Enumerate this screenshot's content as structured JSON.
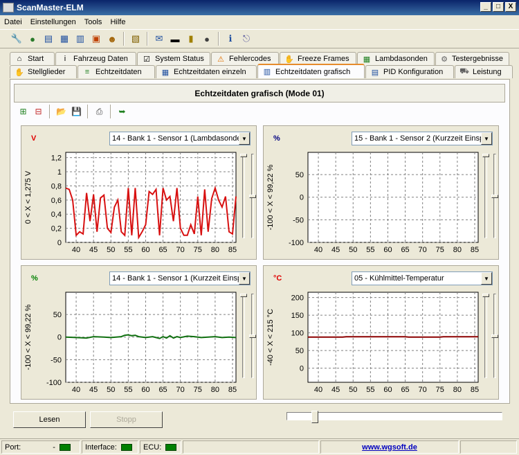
{
  "window": {
    "title": "ScanMaster-ELM",
    "btn_min": "_",
    "btn_max": "□",
    "btn_close": "X"
  },
  "menu": [
    "Datei",
    "Einstellungen",
    "Tools",
    "Hilfe"
  ],
  "tabs_row1": [
    {
      "label": "Start",
      "icon": "home-icon",
      "glyph": "⌂"
    },
    {
      "label": "Fahrzeug Daten",
      "icon": "info-icon",
      "glyph": "i"
    },
    {
      "label": "System Status",
      "icon": "check-icon",
      "glyph": "☑"
    },
    {
      "label": "Fehlercodes",
      "icon": "warning-icon",
      "glyph": "⚠"
    },
    {
      "label": "Freeze Frames",
      "icon": "hand-icon",
      "glyph": "✋"
    },
    {
      "label": "Lambdasonden",
      "icon": "sensor-icon",
      "glyph": "▦"
    },
    {
      "label": "Testergebnisse",
      "icon": "gear-icon",
      "glyph": "⚙"
    }
  ],
  "tabs_row2": [
    {
      "label": "Stellglieder",
      "icon": "hand-icon",
      "glyph": "✋"
    },
    {
      "label": "Echtzeitdaten",
      "icon": "list-icon",
      "glyph": "≡"
    },
    {
      "label": "Echtzeitdaten einzeln",
      "icon": "grid-icon",
      "glyph": "▦"
    },
    {
      "label": "Echtzeitdaten grafisch",
      "icon": "chart-icon",
      "glyph": "▥",
      "active": true
    },
    {
      "label": "PID Konfiguration",
      "icon": "doc-icon",
      "glyph": "▤"
    },
    {
      "label": "Leistung",
      "icon": "car-icon",
      "glyph": "⛟"
    }
  ],
  "header": "Echtzeitdaten grafisch (Mode 01)",
  "charts": [
    {
      "unit": "V",
      "unit_color": "#e00000",
      "sensor": "14 - Bank 1 - Sensor 1 (Lambdasonde ...",
      "range_min": "0",
      "range_sep": "< X <",
      "range_max": "1,275",
      "range_unit": "V",
      "line_color": "#d81010",
      "thumb_pos": 0.5,
      "chart_data": {
        "type": "line",
        "x_ticks": [
          "40",
          "45",
          "50",
          "55",
          "60",
          "65",
          "70",
          "75",
          "80",
          "85"
        ],
        "y_ticks": [
          "1,2",
          "1",
          "0,8",
          "0,6",
          "0,4",
          "0,2",
          "0"
        ],
        "ylim": [
          0,
          1.275
        ],
        "xlim": [
          37,
          86
        ],
        "series": [
          {
            "values": [
              [
                37,
                0.77
              ],
              [
                38,
                0.75
              ],
              [
                39,
                0.6
              ],
              [
                40,
                0.1
              ],
              [
                41,
                0.15
              ],
              [
                42,
                0.12
              ],
              [
                43,
                0.7
              ],
              [
                44,
                0.3
              ],
              [
                45,
                0.68
              ],
              [
                46,
                0.15
              ],
              [
                47,
                0.63
              ],
              [
                48,
                0.67
              ],
              [
                49,
                0.2
              ],
              [
                50,
                0.14
              ],
              [
                51,
                0.5
              ],
              [
                52,
                0.6
              ],
              [
                53,
                0.15
              ],
              [
                54,
                0.1
              ],
              [
                55,
                0.77
              ],
              [
                56,
                0.1
              ],
              [
                57,
                0.77
              ],
              [
                58,
                0.07
              ],
              [
                59,
                0.15
              ],
              [
                60,
                0.25
              ],
              [
                61,
                0.72
              ],
              [
                62,
                0.68
              ],
              [
                63,
                0.75
              ],
              [
                64,
                0.1
              ],
              [
                65,
                0.77
              ],
              [
                66,
                0.6
              ],
              [
                67,
                0.65
              ],
              [
                68,
                0.3
              ],
              [
                69,
                0.77
              ],
              [
                70,
                0.2
              ],
              [
                71,
                0.1
              ],
              [
                72,
                0.1
              ],
              [
                73,
                0.25
              ],
              [
                74,
                0.12
              ],
              [
                75,
                0.65
              ],
              [
                76,
                0.1
              ],
              [
                77,
                0.75
              ],
              [
                78,
                0.15
              ],
              [
                79,
                0.62
              ],
              [
                80,
                0.77
              ],
              [
                81,
                0.6
              ],
              [
                82,
                0.5
              ],
              [
                83,
                0.65
              ],
              [
                84,
                0.15
              ],
              [
                85,
                0.12
              ],
              [
                86,
                0.65
              ]
            ]
          }
        ]
      }
    },
    {
      "unit": "%",
      "unit_color": "#000080",
      "sensor": "15 - Bank 1 - Sensor 2 (Kurzzeit Einspr",
      "range_min": "-100",
      "range_sep": "< X <",
      "range_max": "99,22",
      "range_unit": "%",
      "line_color": "#000080",
      "thumb_pos": 0.5,
      "chart_data": {
        "type": "line",
        "x_ticks": [
          "40",
          "45",
          "50",
          "55",
          "60",
          "65",
          "70",
          "75",
          "80",
          "85"
        ],
        "y_ticks": [
          "50",
          "0",
          "-50",
          "-100"
        ],
        "ylim": [
          -100,
          99.22
        ],
        "xlim": [
          37,
          86
        ],
        "series": []
      }
    },
    {
      "unit": "%",
      "unit_color": "#008000",
      "sensor": "14 - Bank 1 - Sensor 1 (Kurzzeit Einspr",
      "range_min": "-100",
      "range_sep": "< X <",
      "range_max": "99,22",
      "range_unit": "%",
      "line_color": "#107010",
      "thumb_pos": 0.5,
      "chart_data": {
        "type": "line",
        "x_ticks": [
          "40",
          "45",
          "50",
          "55",
          "60",
          "65",
          "70",
          "75",
          "80",
          "85"
        ],
        "y_ticks": [
          "50",
          "0",
          "-50",
          "-100"
        ],
        "ylim": [
          -100,
          99.22
        ],
        "xlim": [
          37,
          86
        ],
        "series": [
          {
            "values": [
              [
                37,
                0
              ],
              [
                40,
                -1
              ],
              [
                43,
                -2
              ],
              [
                45,
                1
              ],
              [
                48,
                0
              ],
              [
                50,
                -1
              ],
              [
                53,
                1
              ],
              [
                54,
                4
              ],
              [
                55,
                5
              ],
              [
                56,
                3
              ],
              [
                57,
                4
              ],
              [
                58,
                1
              ],
              [
                60,
                -1
              ],
              [
                62,
                1
              ],
              [
                63,
                -1
              ],
              [
                64,
                -3
              ],
              [
                65,
                1
              ],
              [
                66,
                -2
              ],
              [
                67,
                3
              ],
              [
                68,
                -2
              ],
              [
                69,
                1
              ],
              [
                70,
                -1
              ],
              [
                72,
                2
              ],
              [
                74,
                1
              ],
              [
                76,
                -1
              ],
              [
                78,
                0
              ],
              [
                80,
                1
              ],
              [
                82,
                -1
              ],
              [
                84,
                0
              ],
              [
                86,
                -1
              ]
            ]
          }
        ]
      }
    },
    {
      "unit": "°C",
      "unit_color": "#e00000",
      "sensor": "05 - Kühlmittel-Temperatur",
      "range_min": "-40",
      "range_sep": "< X <",
      "range_max": "215",
      "range_unit": "°C",
      "line_color": "#8b0000",
      "thumb_pos": 0.5,
      "chart_data": {
        "type": "line",
        "x_ticks": [
          "40",
          "45",
          "50",
          "55",
          "60",
          "65",
          "70",
          "75",
          "80",
          "85"
        ],
        "y_ticks": [
          "200",
          "150",
          "100",
          "50",
          "0"
        ],
        "ylim": [
          -40,
          215
        ],
        "xlim": [
          37,
          86
        ],
        "series": [
          {
            "values": [
              [
                37,
                88
              ],
              [
                47,
                88
              ],
              [
                48,
                89
              ],
              [
                65,
                89
              ],
              [
                66,
                88
              ],
              [
                75,
                88
              ],
              [
                76,
                89
              ],
              [
                86,
                89
              ]
            ]
          }
        ]
      }
    }
  ],
  "buttons": {
    "read": "Lesen",
    "stop": "Stopp"
  },
  "status": {
    "port_label": "Port:",
    "port_value": "-",
    "interface_label": "Interface:",
    "ecu_label": "ECU:",
    "link": "www.wgsoft.de"
  }
}
